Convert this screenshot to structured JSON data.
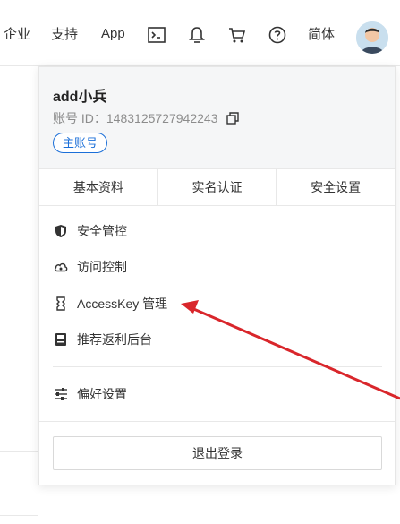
{
  "topbar": {
    "links": [
      "企业",
      "支持",
      "App"
    ],
    "icons": [
      "terminal-icon",
      "bell-icon",
      "cart-icon",
      "help-icon"
    ],
    "language": "简体"
  },
  "panel": {
    "username": "add小兵",
    "account_id_label": "账号 ID：",
    "account_id": "1483125727942243",
    "badge": "主账号",
    "tabs": [
      "基本资料",
      "实名认证",
      "安全设置"
    ],
    "menu": [
      {
        "icon": "shield-icon",
        "label": "安全管控"
      },
      {
        "icon": "cloud-icon",
        "label": "访问控制"
      },
      {
        "icon": "key-icon",
        "label": "AccessKey 管理"
      },
      {
        "icon": "referral-icon",
        "label": "推荐返利后台"
      }
    ],
    "preferences": {
      "icon": "sliders-icon",
      "label": "偏好设置"
    },
    "logout": "退出登录"
  },
  "annotation": {
    "color": "#d9262b"
  }
}
